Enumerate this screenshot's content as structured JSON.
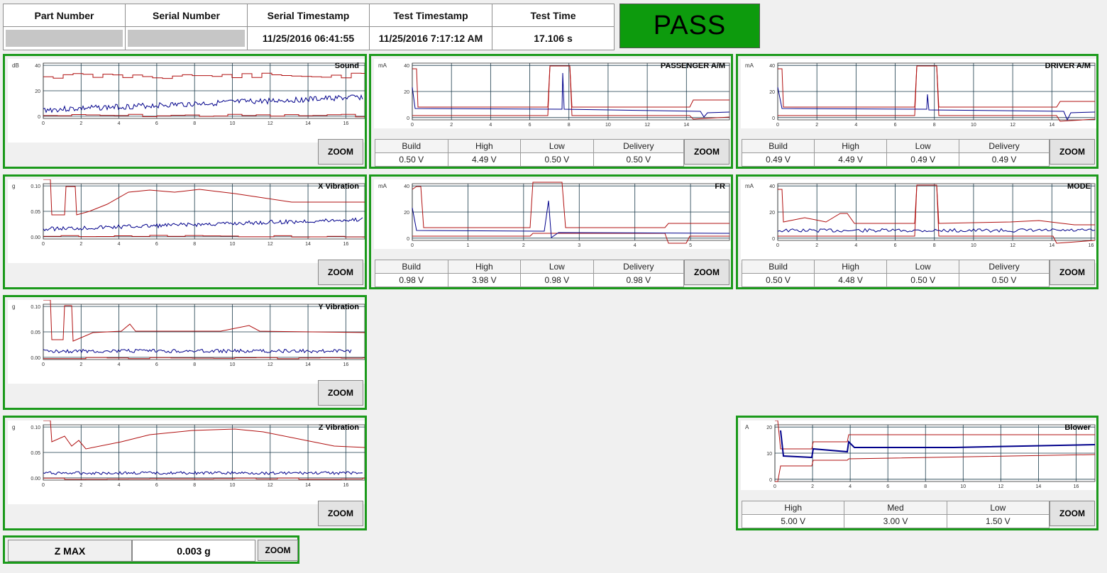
{
  "header": {
    "columns": [
      "Part Number",
      "Serial Number",
      "Serial Timestamp",
      "Test Timestamp",
      "Test Time"
    ],
    "values": [
      "",
      "",
      "11/25/2016 06:41:55",
      "11/25/2016 7:17:12 AM",
      "17.106 s"
    ]
  },
  "status": {
    "label": "PASS",
    "color": "#0d9b0d"
  },
  "colors": {
    "limit": "#b01010",
    "signal": "#00008b",
    "grid": "#1a3a4a",
    "panel_border": "#1b9a1b"
  },
  "zoom_label": "ZOOM",
  "panels": {
    "sound": {
      "title": "Sound",
      "unit": "dB",
      "yticks": [
        "40",
        "20",
        "0"
      ],
      "xticks": [
        "0",
        "2",
        "4",
        "6",
        "8",
        "10",
        "12",
        "14",
        "16"
      ]
    },
    "passenger": {
      "title": "PASSENGER A/M",
      "unit": "mA",
      "yticks": [
        "40",
        "20",
        "0"
      ],
      "xticks": [
        "0",
        "2",
        "4",
        "6",
        "8",
        "10",
        "12",
        "14"
      ],
      "table": {
        "headers": [
          "Build",
          "High",
          "Low",
          "Delivery"
        ],
        "values": [
          "0.50 V",
          "4.49 V",
          "0.50 V",
          "0.50 V"
        ]
      }
    },
    "driver": {
      "title": "DRIVER A/M",
      "unit": "mA",
      "yticks": [
        "40",
        "20",
        "0"
      ],
      "xticks": [
        "0",
        "2",
        "4",
        "6",
        "8",
        "10",
        "12",
        "14"
      ],
      "table": {
        "headers": [
          "Build",
          "High",
          "Low",
          "Delivery"
        ],
        "values": [
          "0.49 V",
          "4.49 V",
          "0.49 V",
          "0.49 V"
        ]
      }
    },
    "xvib": {
      "title": "X Vibration",
      "unit": "g",
      "yticks": [
        "0.10",
        "0.05",
        "0.00"
      ],
      "xticks": [
        "0",
        "2",
        "4",
        "6",
        "8",
        "10",
        "12",
        "14",
        "16"
      ]
    },
    "fr": {
      "title": "FR",
      "unit": "mA",
      "yticks": [
        "40",
        "20",
        "0"
      ],
      "xticks": [
        "0",
        "1",
        "2",
        "3",
        "4",
        "5"
      ],
      "table": {
        "headers": [
          "Build",
          "High",
          "Low",
          "Delivery"
        ],
        "values": [
          "0.98 V",
          "3.98 V",
          "0.98 V",
          "0.98 V"
        ]
      }
    },
    "mode": {
      "title": "MODE",
      "unit": "mA",
      "yticks": [
        "40",
        "20",
        "0"
      ],
      "xticks": [
        "0",
        "2",
        "4",
        "6",
        "8",
        "10",
        "12",
        "14",
        "16"
      ],
      "table": {
        "headers": [
          "Build",
          "High",
          "Low",
          "Delivery"
        ],
        "values": [
          "0.50 V",
          "4.48 V",
          "0.50 V",
          "0.50 V"
        ]
      }
    },
    "yvib": {
      "title": "Y Vibration",
      "unit": "g",
      "yticks": [
        "0.10",
        "0.05",
        "0.00"
      ],
      "xticks": [
        "0",
        "2",
        "4",
        "6",
        "8",
        "10",
        "12",
        "14",
        "16"
      ]
    },
    "zvib": {
      "title": "Z Vibration",
      "unit": "g",
      "yticks": [
        "0.10",
        "0.05",
        "0.00"
      ],
      "xticks": [
        "0",
        "2",
        "4",
        "6",
        "8",
        "10",
        "12",
        "14",
        "16"
      ]
    },
    "blower": {
      "title": "Blower",
      "unit": "A",
      "yticks": [
        "20",
        "10",
        "0"
      ],
      "xticks": [
        "0",
        "2",
        "4",
        "6",
        "8",
        "10",
        "12",
        "14",
        "16"
      ],
      "table": {
        "headers": [
          "High",
          "Med",
          "Low"
        ],
        "values": [
          "5.00 V",
          "3.00 V",
          "1.50 V"
        ]
      }
    }
  },
  "zmax": {
    "label": "Z MAX",
    "value": "0.003 g"
  }
}
